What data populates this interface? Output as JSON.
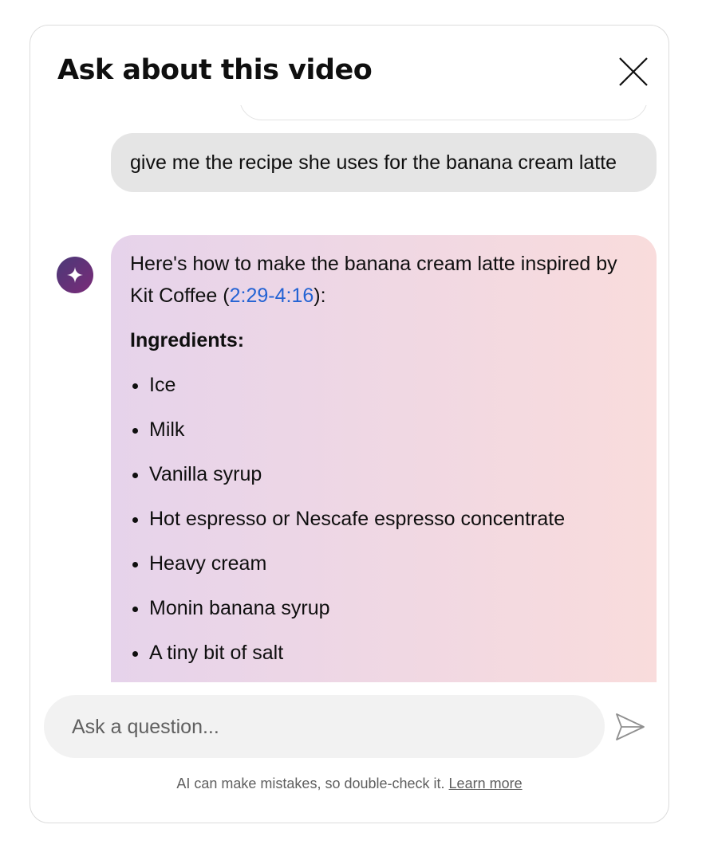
{
  "header": {
    "title": "Ask about this video"
  },
  "messages": {
    "user": "give me the recipe she uses for the banana cream latte",
    "ai": {
      "intro_1": "Here's how to make the banana cream latte inspired by Kit Coffee (",
      "ts_start": "2:29",
      "dash": "-",
      "ts_end": "4:16",
      "intro_2": "):",
      "heading": "Ingredients:",
      "items": [
        "Ice",
        "Milk",
        "Vanilla syrup",
        "Hot espresso or Nescafe espresso concentrate",
        "Heavy cream",
        "Monin banana syrup",
        "A tiny bit of salt"
      ]
    }
  },
  "input": {
    "placeholder": "Ask a question..."
  },
  "footer": {
    "disclaimer": "AI can make mistakes, so double-check it.",
    "learn_more": "Learn more"
  }
}
